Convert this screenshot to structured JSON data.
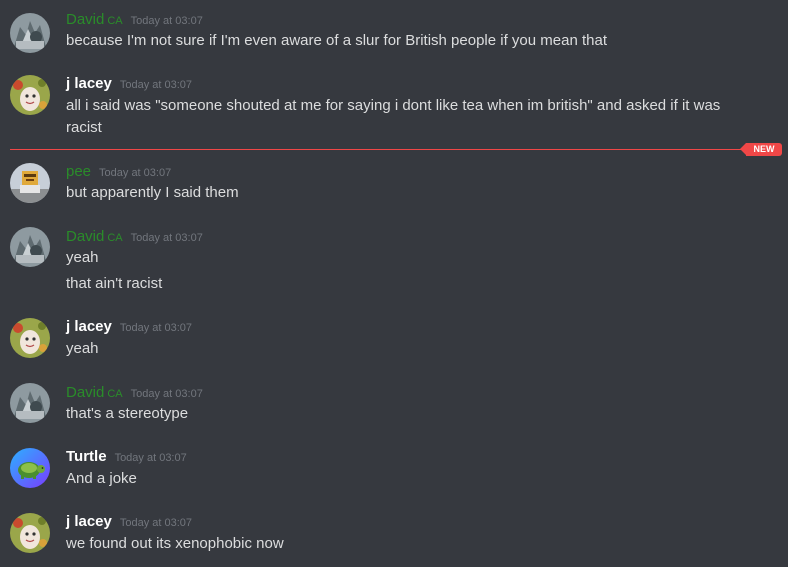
{
  "divider": {
    "label": "NEW"
  },
  "users": {
    "david": {
      "name": "David",
      "tag": "CA"
    },
    "jlacey": {
      "name": "j lacey"
    },
    "pee": {
      "name": "pee"
    },
    "turtle": {
      "name": "Turtle"
    }
  },
  "messages": [
    {
      "time": "Today at 03:07",
      "lines": [
        "because I'm not sure if I'm even aware of a slur for British people if you mean that"
      ]
    },
    {
      "time": "Today at 03:07",
      "lines": [
        "all i said was \"someone shouted at me for saying i dont like tea when im british\" and asked if it was racist"
      ]
    },
    {
      "time": "Today at 03:07",
      "lines": [
        "but apparently I said them"
      ]
    },
    {
      "time": "Today at 03:07",
      "lines": [
        "yeah",
        "that ain't racist"
      ]
    },
    {
      "time": "Today at 03:07",
      "lines": [
        "yeah"
      ]
    },
    {
      "time": "Today at 03:07",
      "lines": [
        "that's a stereotype"
      ]
    },
    {
      "time": "Today at 03:07",
      "lines": [
        "And a joke"
      ]
    },
    {
      "time": "Today at 03:07",
      "lines": [
        "we found out its xenophobic now"
      ]
    }
  ]
}
